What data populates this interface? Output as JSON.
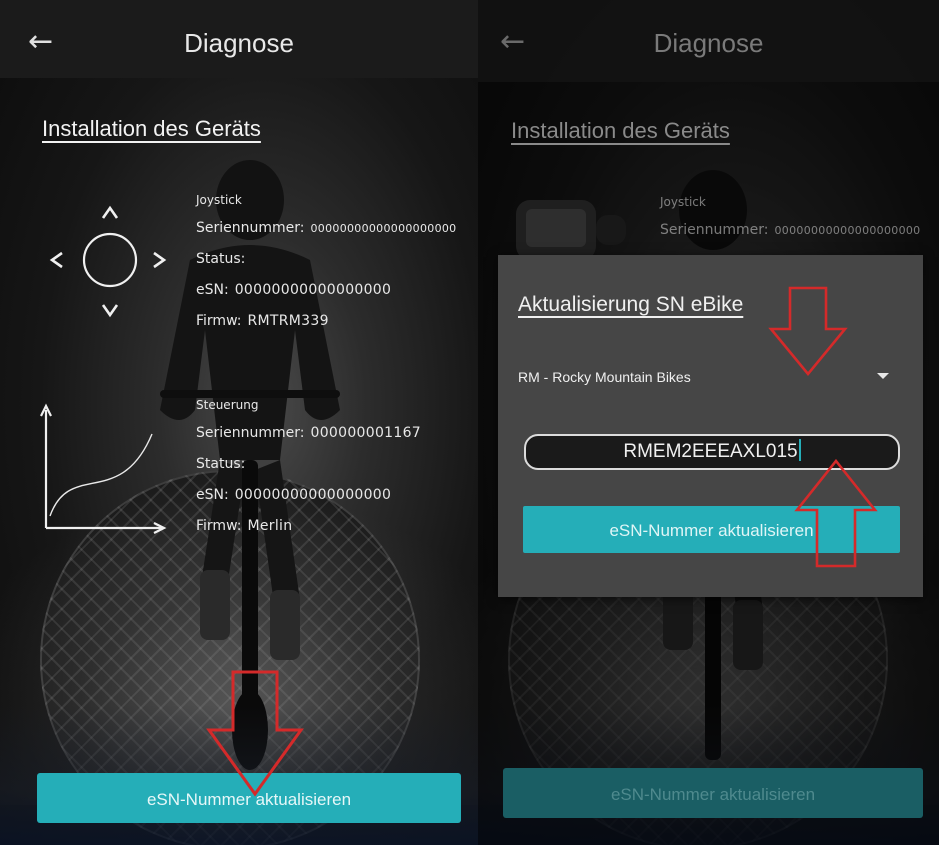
{
  "left_screen": {
    "appbar": {
      "title": "Diagnose"
    },
    "section_title": "Installation des Geräts",
    "joystick": {
      "name": "Joystick",
      "serial_label": "Seriennummer:",
      "serial_value": "00000000000000000000",
      "status_label": "Status:",
      "status_value": "",
      "esn_label": "eSN:",
      "esn_value": "00000000000000000",
      "firmware_label": "Firmw:",
      "firmware_value": "RMTRM339"
    },
    "controller": {
      "name": "Steuerung",
      "serial_label": "Seriennummer:",
      "serial_value": "000000001167",
      "status_label": "Status:",
      "status_value": "",
      "esn_label": "eSN:",
      "esn_value": "00000000000000000",
      "firmware_label": "Firmw:",
      "firmware_value": "Merlin"
    },
    "bottom_button": "eSN-Nummer aktualisieren"
  },
  "right_screen": {
    "appbar": {
      "title": "Diagnose"
    },
    "section_title": "Installation des Geräts",
    "joystick": {
      "name": "Joystick",
      "serial_label": "Seriennummer:",
      "serial_value": "00000000000000000000"
    },
    "dialog": {
      "title": "Aktualisierung SN eBike",
      "brand_select_value": "RM - Rocky Mountain Bikes",
      "esn_input_value": "RMEM2EEEAXL015",
      "update_button": "eSN-Nummer aktualisieren"
    },
    "bottom_button": "eSN-Nummer aktualisieren"
  },
  "colors": {
    "accent": "#25aeb8",
    "appbar": "#1b1b1b",
    "dialog": "#464646",
    "annotation_arrow": "#d42a2a"
  },
  "icons": [
    "back-arrow-icon",
    "joystick-icon",
    "curve-graph-icon",
    "chevron-down-icon",
    "annotation-arrow"
  ]
}
